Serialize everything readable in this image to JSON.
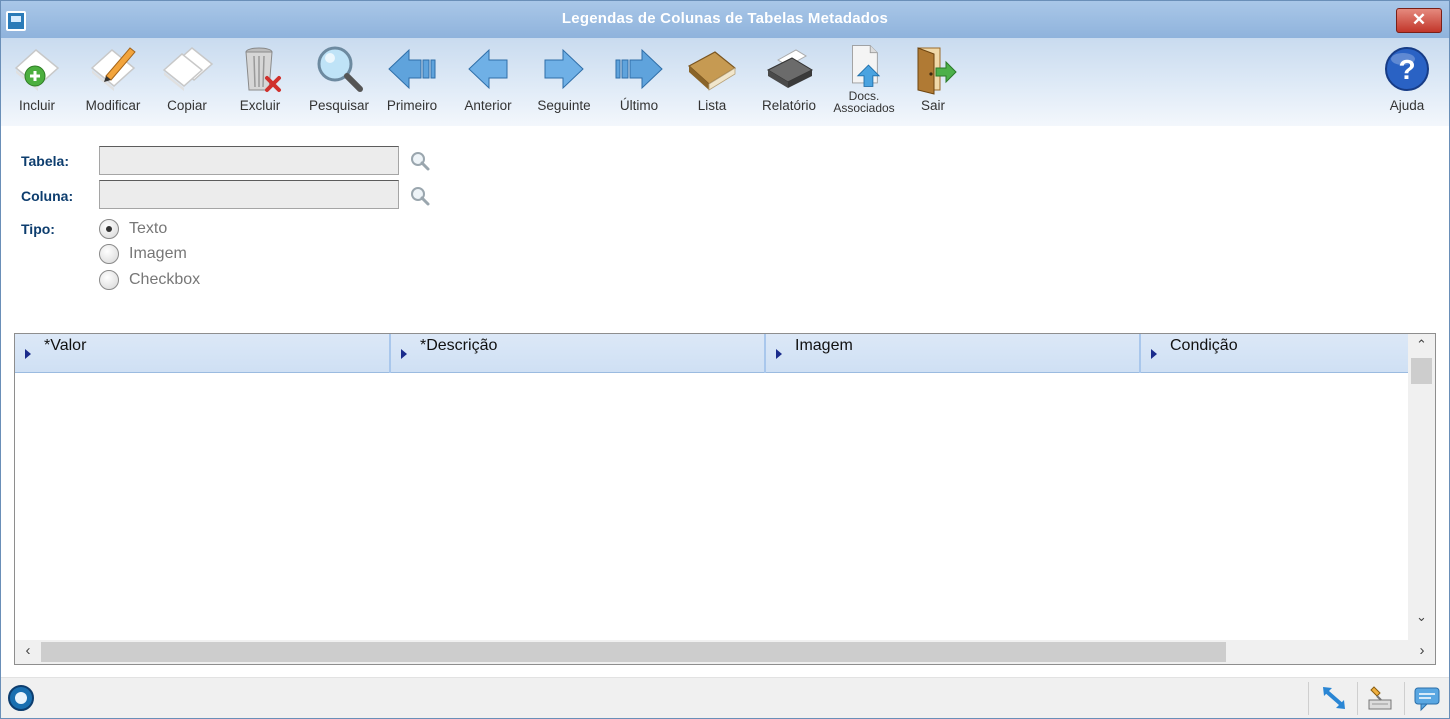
{
  "window": {
    "title": "Legendas de Colunas de Tabelas Metadados",
    "close_label": "✕"
  },
  "toolbar": {
    "incluir": "Incluir",
    "modificar": "Modificar",
    "copiar": "Copiar",
    "excluir": "Excluir",
    "pesquisar": "Pesquisar",
    "primeiro": "Primeiro",
    "anterior": "Anterior",
    "seguinte": "Seguinte",
    "ultimo": "Último",
    "lista": "Lista",
    "relatorio": "Relatório",
    "docs_line1": "Docs.",
    "docs_line2": "Associados",
    "sair": "Sair",
    "ajuda": "Ajuda"
  },
  "form": {
    "tabela_label": "Tabela:",
    "tabela_value": "",
    "coluna_label": "Coluna:",
    "coluna_value": "",
    "tipo_label": "Tipo:",
    "tipo_options": [
      "Texto",
      "Imagem",
      "Checkbox"
    ],
    "tipo_selected": "Texto"
  },
  "grid": {
    "columns": [
      "*Valor",
      "*Descrição",
      "Imagem",
      "Condição"
    ],
    "rows": []
  },
  "colors": {
    "title_bar": "#8fb3dc",
    "label": "#0d3d6e",
    "header": "#cfe0f4"
  }
}
